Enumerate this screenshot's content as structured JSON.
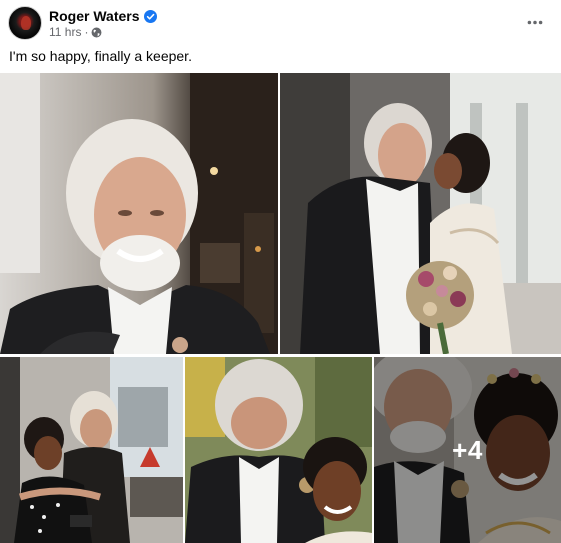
{
  "post": {
    "author": "Roger Waters",
    "timestamp": "11 hrs",
    "separator": "·",
    "caption": "I'm so happy, finally a keeper.",
    "avatar_icon": "profile-avatar",
    "verified_icon": "verified-badge-icon",
    "audience_icon": "globe-icon",
    "menu_icon": "more-options-icon"
  },
  "gallery": {
    "photos": [
      {
        "description_icon": "photo"
      },
      {
        "description_icon": "photo"
      },
      {
        "description_icon": "photo"
      },
      {
        "description_icon": "photo"
      },
      {
        "description_icon": "photo"
      }
    ],
    "more_count_label": "+4"
  },
  "colors": {
    "verified": "#1877f2",
    "meta_text": "#65676b",
    "text": "#050505",
    "overlay": "rgba(0,0,0,0.42)"
  }
}
